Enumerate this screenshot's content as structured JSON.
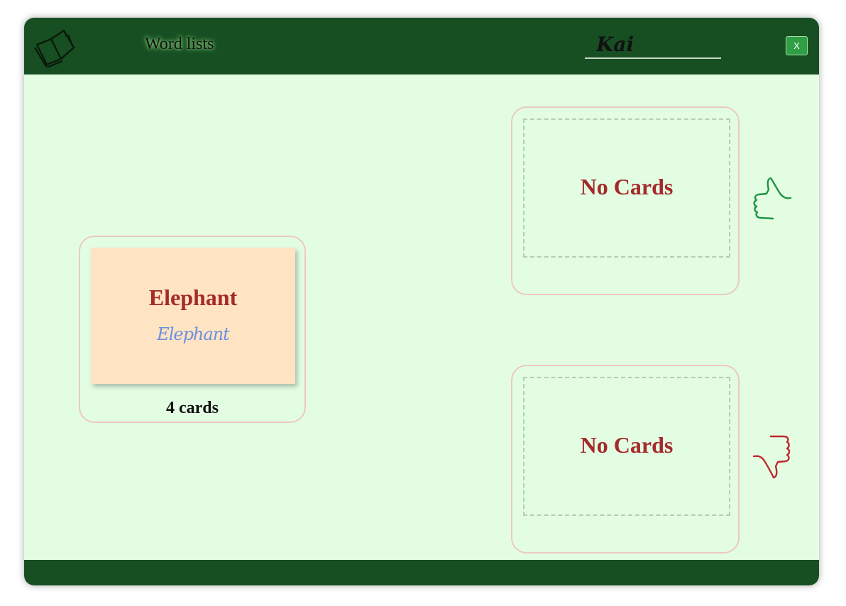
{
  "header": {
    "title": "Word lists",
    "player_name": "Kai",
    "close_label": "X"
  },
  "deck": {
    "current_card": {
      "word": "Elephant",
      "script_word": "Elephant"
    },
    "count_label": "4 cards"
  },
  "piles": {
    "known": {
      "empty_label": "No Cards",
      "icon": "thumbs-up-icon"
    },
    "unknown": {
      "empty_label": "No Cards",
      "icon": "thumbs-down-icon"
    }
  },
  "colors": {
    "header_bg": "#174f23",
    "app_bg": "#e3fde3",
    "card_bg": "#ffe4c4",
    "accent_text": "#a52a2a",
    "thumb_up": "#1e9440",
    "thumb_down": "#c0282d"
  }
}
